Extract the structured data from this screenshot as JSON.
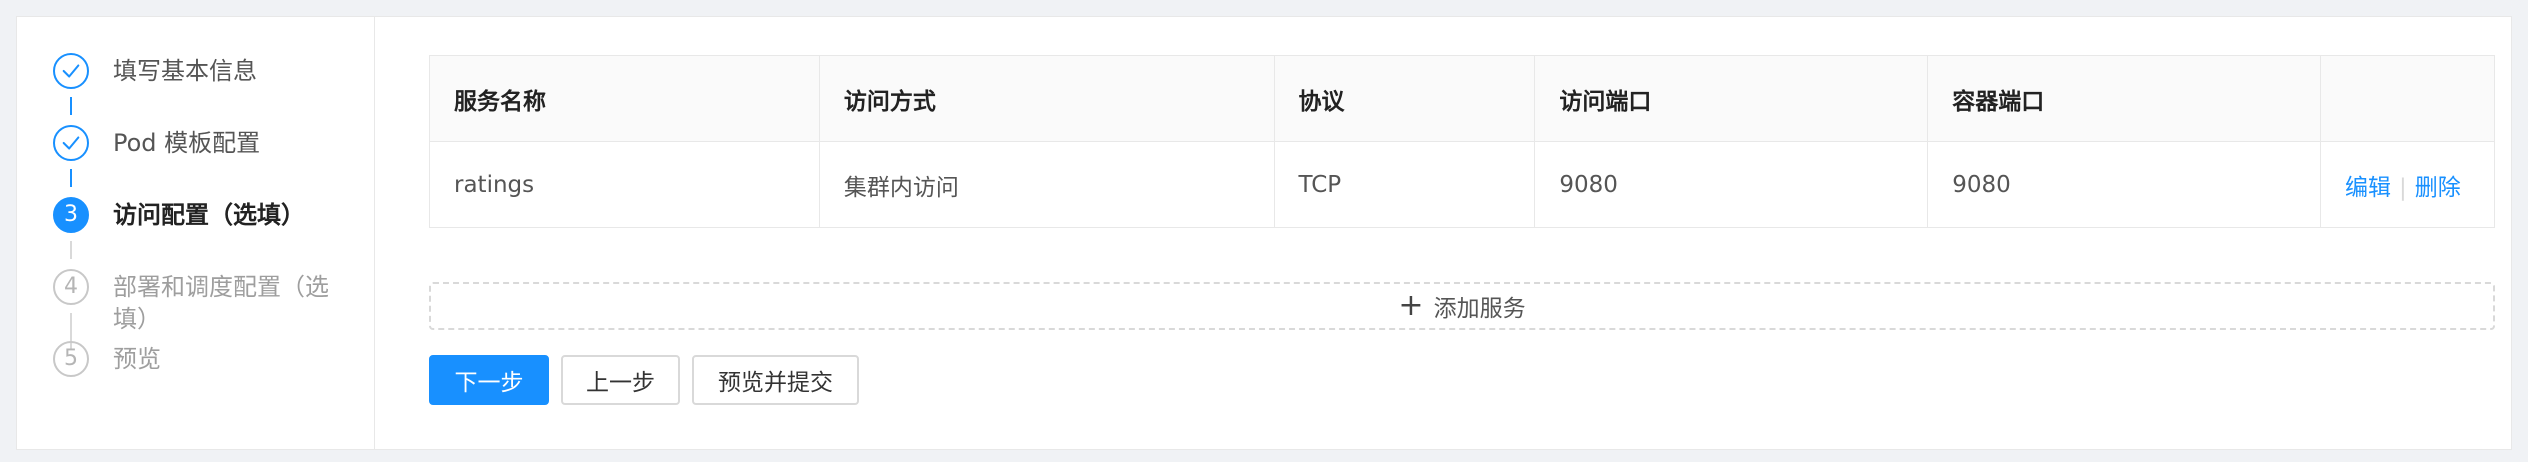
{
  "steps": [
    {
      "number": "1",
      "label": "填写基本信息",
      "status": "done",
      "icon": "check-icon"
    },
    {
      "number": "2",
      "label": "Pod 模板配置",
      "status": "done",
      "icon": "check-icon"
    },
    {
      "number": "3",
      "label": "访问配置（选填）",
      "status": "active"
    },
    {
      "number": "4",
      "label": "部署和调度配置（选填）",
      "status": "wait"
    },
    {
      "number": "5",
      "label": "预览",
      "status": "wait"
    }
  ],
  "table": {
    "columns": [
      "服务名称",
      "访问方式",
      "协议",
      "访问端口",
      "容器端口",
      ""
    ],
    "rows": [
      {
        "name": "ratings",
        "access": "集群内访问",
        "protocol": "TCP",
        "port": "9080",
        "target_port": "9080",
        "edit": "编辑",
        "delete": "删除"
      }
    ]
  },
  "add_service": {
    "label": "添加服务",
    "icon": "plus-icon"
  },
  "buttons": {
    "next": "下一步",
    "prev": "上一步",
    "submit": "预览并提交"
  },
  "colors": {
    "primary": "#1890ff",
    "border": "#e8e8e8",
    "background": "#f0f2f5"
  }
}
